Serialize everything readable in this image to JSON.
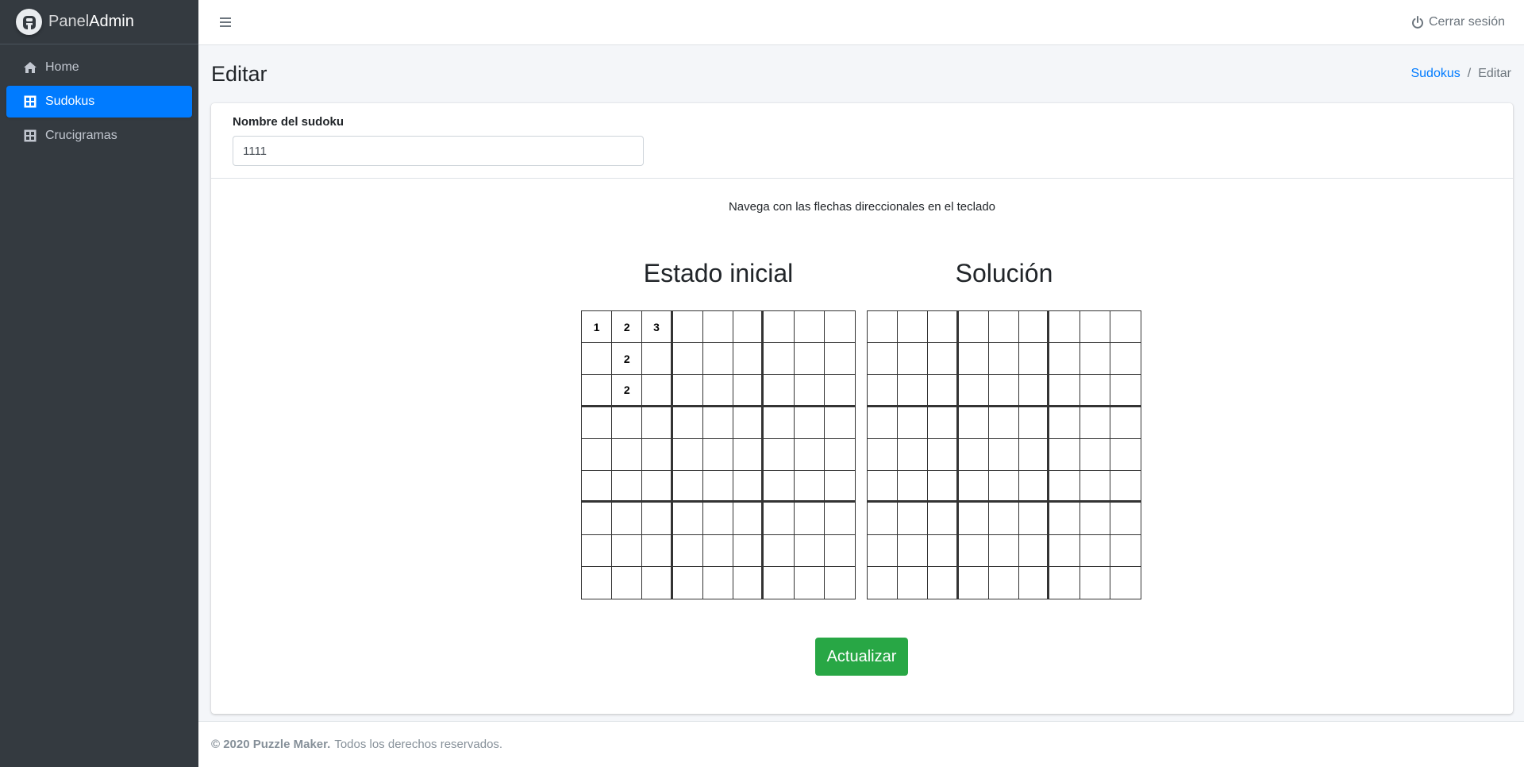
{
  "brand": {
    "part1": "Panel",
    "part2": "Admin"
  },
  "sidebar": {
    "items": [
      {
        "label": "Home",
        "icon": "home-icon"
      },
      {
        "label": "Sudokus",
        "icon": "grid-icon",
        "active": true
      },
      {
        "label": "Crucigramas",
        "icon": "grid-icon"
      }
    ]
  },
  "header": {
    "logout_label": "Cerrar sesión"
  },
  "page": {
    "title": "Editar"
  },
  "breadcrumb": {
    "parent": "Sudokus",
    "current": "Editar"
  },
  "form": {
    "name_label": "Nombre del sudoku",
    "name_value": "1111"
  },
  "hint": "Navega con las flechas direccionales en el teclado",
  "initial_grid": {
    "title": "Estado inicial",
    "cells": [
      [
        "1",
        "2",
        "3",
        "",
        "",
        "",
        "",
        "",
        ""
      ],
      [
        "",
        "2",
        "",
        "",
        "",
        "",
        "",
        "",
        ""
      ],
      [
        "",
        "2",
        "",
        "",
        "",
        "",
        "",
        "",
        ""
      ],
      [
        "",
        "",
        "",
        "",
        "",
        "",
        "",
        "",
        ""
      ],
      [
        "",
        "",
        "",
        "",
        "",
        "",
        "",
        "",
        ""
      ],
      [
        "",
        "",
        "",
        "",
        "",
        "",
        "",
        "",
        ""
      ],
      [
        "",
        "",
        "",
        "",
        "",
        "",
        "",
        "",
        ""
      ],
      [
        "",
        "",
        "",
        "",
        "",
        "",
        "",
        "",
        ""
      ],
      [
        "",
        "",
        "",
        "",
        "",
        "",
        "",
        "",
        ""
      ]
    ]
  },
  "solution_grid": {
    "title": "Solución",
    "cells": [
      [
        "",
        "",
        "",
        "",
        "",
        "",
        "",
        "",
        ""
      ],
      [
        "",
        "",
        "",
        "",
        "",
        "",
        "",
        "",
        ""
      ],
      [
        "",
        "",
        "",
        "",
        "",
        "",
        "",
        "",
        ""
      ],
      [
        "",
        "",
        "",
        "",
        "",
        "",
        "",
        "",
        ""
      ],
      [
        "",
        "",
        "",
        "",
        "",
        "",
        "",
        "",
        ""
      ],
      [
        "",
        "",
        "",
        "",
        "",
        "",
        "",
        "",
        ""
      ],
      [
        "",
        "",
        "",
        "",
        "",
        "",
        "",
        "",
        ""
      ],
      [
        "",
        "",
        "",
        "",
        "",
        "",
        "",
        "",
        ""
      ],
      [
        "",
        "",
        "",
        "",
        "",
        "",
        "",
        "",
        ""
      ]
    ]
  },
  "actions": {
    "update_label": "Actualizar"
  },
  "footer": {
    "copyright": "© 2020 Puzzle Maker.",
    "rights": "Todos los derechos reservados."
  },
  "colors": {
    "primary": "#007bff",
    "success": "#28a745",
    "sidebar": "#343a40"
  }
}
